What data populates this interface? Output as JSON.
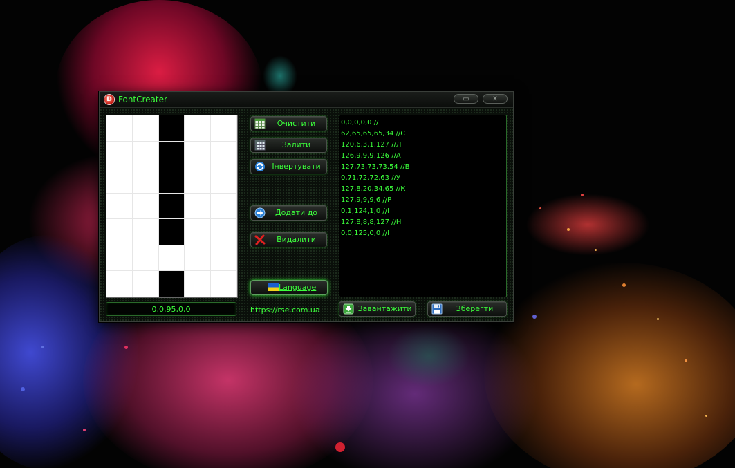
{
  "window": {
    "title": "FontCreater",
    "icon_letter": "D",
    "minimize_glyph": "▭",
    "close_glyph": "✕"
  },
  "pixel_grid": {
    "columns": 5,
    "rows": 7,
    "on_cells": [
      [
        2,
        0
      ],
      [
        2,
        1
      ],
      [
        2,
        2
      ],
      [
        2,
        3
      ],
      [
        2,
        4
      ],
      [
        2,
        6
      ]
    ]
  },
  "code_field": {
    "value": "0,0,95,0,0"
  },
  "buttons": {
    "clear": "Очистити",
    "fill": "Залити",
    "invert": "Інвертувати",
    "add": "Додати до",
    "delete": "Видалити",
    "language": "Language",
    "load": "Завантажити",
    "save": "Зберегти"
  },
  "site_link": "https://rse.com.ua",
  "code_list": [
    "0,0,0,0,0 //",
    "62,65,65,65,34 //С",
    "120,6,3,1,127 //Л",
    "126,9,9,9,126 //А",
    "127,73,73,73,54 //В",
    "0,71,72,72,63 //У",
    "127,8,20,34,65 //К",
    "127,9,9,9,6 //Р",
    "0,1,124,1,0 //Ї",
    "127,8,8,8,127 //Н",
    "0,0,125,0,0 //І"
  ],
  "colors": {
    "accent_green": "#3bff3b",
    "window_bg": "#0a0f0a"
  }
}
